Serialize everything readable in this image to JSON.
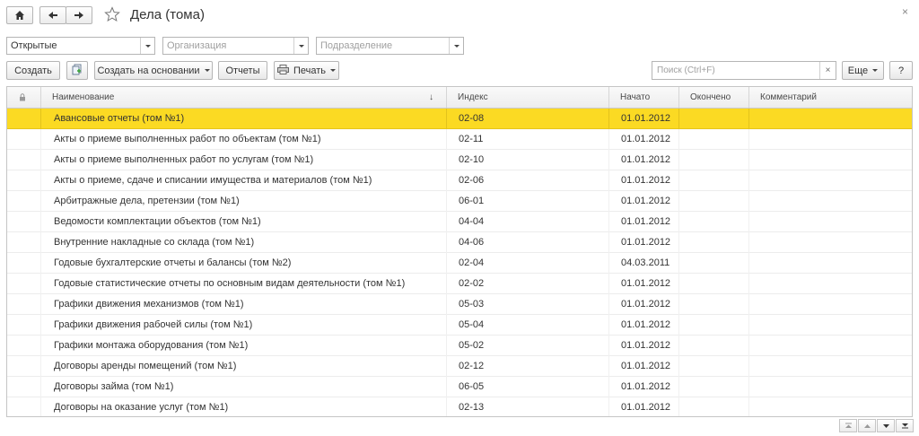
{
  "window": {
    "title": "Дела (тома)",
    "close_glyph": "×"
  },
  "filters": [
    {
      "value": "Открытые",
      "placeholder": ""
    },
    {
      "value": "",
      "placeholder": "Организация"
    },
    {
      "value": "",
      "placeholder": "Подразделение"
    }
  ],
  "toolbar": {
    "create_label": "Создать",
    "create_based_label": "Создать на основании",
    "reports_label": "Отчеты",
    "print_label": "Печать",
    "search_placeholder": "Поиск (Ctrl+F)",
    "search_clear": "×",
    "more_label": "Еще",
    "help_label": "?"
  },
  "table": {
    "columns": {
      "name": "Наименование",
      "sort_indicator": "↓",
      "index": "Индекс",
      "start": "Начато",
      "end": "Окончено",
      "comment": "Комментарий"
    },
    "rows": [
      {
        "name": "Авансовые отчеты (том №1)",
        "index": "02-08",
        "start": "01.01.2012",
        "end": "",
        "comment": "",
        "selected": true
      },
      {
        "name": "Акты о приеме выполненных работ по объектам (том №1)",
        "index": "02-11",
        "start": "01.01.2012",
        "end": "",
        "comment": ""
      },
      {
        "name": "Акты о приеме выполненных работ по услугам (том №1)",
        "index": "02-10",
        "start": "01.01.2012",
        "end": "",
        "comment": ""
      },
      {
        "name": "Акты о приеме, сдаче и списании имущества и материалов (том №1)",
        "index": "02-06",
        "start": "01.01.2012",
        "end": "",
        "comment": ""
      },
      {
        "name": "Арбитражные дела, претензии (том №1)",
        "index": "06-01",
        "start": "01.01.2012",
        "end": "",
        "comment": ""
      },
      {
        "name": "Ведомости комплектации объектов (том №1)",
        "index": "04-04",
        "start": "01.01.2012",
        "end": "",
        "comment": ""
      },
      {
        "name": "Внутренние накладные со склада (том №1)",
        "index": "04-06",
        "start": "01.01.2012",
        "end": "",
        "comment": ""
      },
      {
        "name": "Годовые бухгалтерские отчеты и балансы (том №2)",
        "index": "02-04",
        "start": "04.03.2011",
        "end": "",
        "comment": ""
      },
      {
        "name": "Годовые статистические отчеты по основным видам деятельности (том №1)",
        "index": "02-02",
        "start": "01.01.2012",
        "end": "",
        "comment": ""
      },
      {
        "name": "Графики движения механизмов (том №1)",
        "index": "05-03",
        "start": "01.01.2012",
        "end": "",
        "comment": ""
      },
      {
        "name": "Графики движения рабочей силы (том №1)",
        "index": "05-04",
        "start": "01.01.2012",
        "end": "",
        "comment": ""
      },
      {
        "name": "Графики монтажа оборудования (том №1)",
        "index": "05-02",
        "start": "01.01.2012",
        "end": "",
        "comment": ""
      },
      {
        "name": "Договоры аренды помещений (том №1)",
        "index": "02-12",
        "start": "01.01.2012",
        "end": "",
        "comment": ""
      },
      {
        "name": "Договоры займа (том №1)",
        "index": "06-05",
        "start": "01.01.2012",
        "end": "",
        "comment": ""
      },
      {
        "name": "Договоры на оказание услуг (том №1)",
        "index": "02-13",
        "start": "01.01.2012",
        "end": "",
        "comment": ""
      }
    ]
  },
  "icons": {
    "home": "home-icon",
    "back": "arrow-left-icon",
    "forward": "arrow-right-icon",
    "favorite": "star-icon",
    "copy": "copy-document-icon",
    "print": "printer-icon",
    "lock": "lock-icon",
    "scroll": [
      "scroll-top-icon",
      "scroll-page-up-icon",
      "scroll-page-down-icon",
      "scroll-bottom-icon"
    ]
  },
  "colors": {
    "selected_row": "#fbda23"
  }
}
